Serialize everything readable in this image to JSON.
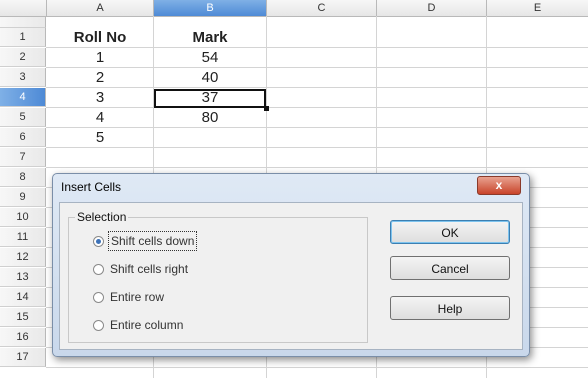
{
  "columns": [
    "A",
    "B",
    "C",
    "D",
    "E"
  ],
  "rows": [
    "1",
    "2",
    "3",
    "4",
    "5",
    "6",
    "7",
    "8",
    "9",
    "10",
    "11",
    "12",
    "13",
    "14",
    "15",
    "16",
    "17"
  ],
  "cells": {
    "a1": "Roll No",
    "b1": "Mark",
    "a2": "1",
    "b2": "54",
    "a3": "2",
    "b3": "40",
    "a4": "3",
    "b4": "37",
    "a5": "4",
    "b5": "80",
    "a6": "5"
  },
  "dialog": {
    "title": "Insert Cells",
    "close_label": "x",
    "selection_label": "Selection",
    "options": [
      "Shift cells down",
      "Shift cells right",
      "Entire row",
      "Entire column"
    ],
    "selected_option": "Shift cells down",
    "ok_label": "OK",
    "cancel_label": "Cancel",
    "help_label": "Help"
  }
}
